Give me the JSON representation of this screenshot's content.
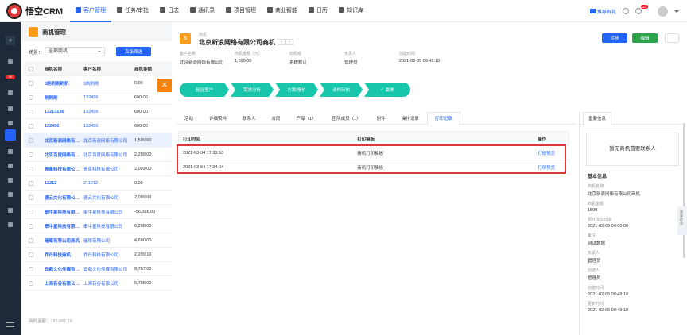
{
  "app": {
    "name": "悟空CRM"
  },
  "nav": {
    "items": [
      {
        "label": "客户管理",
        "active": true
      },
      {
        "label": "任务/审批"
      },
      {
        "label": "日志"
      },
      {
        "label": "通讯录"
      },
      {
        "label": "项目管理"
      },
      {
        "label": "商业智能"
      },
      {
        "label": "日历"
      },
      {
        "label": "知识库"
      }
    ]
  },
  "topright": {
    "upgrade": "推荐有礼",
    "notifications": "22"
  },
  "sidebar": {
    "badge": "99"
  },
  "list_panel": {
    "title": "商机管理",
    "filter_label": "场景：",
    "filter_value": "全部商机",
    "scene_button": "高级筛选",
    "columns": [
      "商机名称",
      "客户名称",
      "商机金额"
    ],
    "rows": [
      {
        "name": "3刷刷刷刷机",
        "customer": "3刷刷刷",
        "amount": "0.00"
      },
      {
        "name": "刷刷刷",
        "customer": "132456",
        "amount": "600.00"
      },
      {
        "name": "13213136",
        "customer": "132456",
        "amount": "600.00"
      },
      {
        "name": "132456",
        "customer": "132456",
        "amount": "600.00"
      },
      {
        "name": "北京新浪网络有限公司商机",
        "customer": "北京新浪网络有限公司",
        "amount": "1,599.00",
        "selected": true
      },
      {
        "name": "北京百度网络有限公司商机",
        "customer": "北京百度网络有限公司",
        "amount": "2,299.00"
      },
      {
        "name": "青蓬科技有限公司商机",
        "customer": "青蓬科技有限公司",
        "amount": "2,099.00"
      },
      {
        "name": "12212",
        "customer": "211212",
        "amount": "0.00"
      },
      {
        "name": "德云文化有限公司商机",
        "customer": "德云文化有限公司",
        "amount": "2,099.00"
      },
      {
        "name": "牵牛星科技有限公司商机",
        "customer": "牵牛星科技有限公司",
        "amount": "-56,388.00"
      },
      {
        "name": "牵牛星科技有限公司商机",
        "customer": "牵牛星科技有限公司",
        "amount": "6,298.00"
      },
      {
        "name": "璀璨有限公司商机",
        "customer": "璀璨有限公司",
        "amount": "4,690.00"
      },
      {
        "name": "乔丹科技商机",
        "customer": "乔丹科技有限公司",
        "amount": "2,209.10"
      },
      {
        "name": "云鼎文化传媒有限公司商机",
        "customer": "云鼎文化传媒有限公司",
        "amount": "8,787.00"
      },
      {
        "name": "上海有谷有限公司商机",
        "customer": "上海有谷有限公司",
        "amount": "5,798.00"
      }
    ],
    "total": "商机金额：155,661.10"
  },
  "detail": {
    "type_label": "商机",
    "title": "北京新浪网络有限公司商机",
    "buttons": {
      "transfer": "转移",
      "edit": "编辑",
      "more": "···"
    },
    "summary": [
      {
        "label": "客户名称",
        "value": "北京新浪网络有限公司"
      },
      {
        "label": "商机金额（元）",
        "value": "1,599.00"
      },
      {
        "label": "商机组",
        "value": "系统默认"
      },
      {
        "label": "负责人",
        "value": "管理员"
      },
      {
        "label": "创建时间",
        "value": "2021-02-05 09:49:18"
      }
    ],
    "stages": [
      "验证客户",
      "需求分析",
      "方案/报价",
      "谈判审核",
      "赢单"
    ],
    "tabs": [
      "活动",
      "详细资料",
      "联系人",
      "合同",
      "产品（1）",
      "团队成员（1）",
      "附件",
      "操作记录",
      "打印记录"
    ],
    "active_tab": 8,
    "print_table": {
      "columns": [
        "打印时间",
        "打印模板",
        "操作"
      ],
      "rows": [
        {
          "time": "2021-03-04 17:33:53",
          "template": "商机打印模板",
          "action": "打印预览"
        },
        {
          "time": "2021-03-04 17:34:04",
          "template": "商机打印模板",
          "action": "打印预览"
        }
      ]
    }
  },
  "right_panel": {
    "tab": "重要信息",
    "empty_contact": "暂无商机首要联系人",
    "section": "基本信息",
    "handle": "重要信息",
    "fields": [
      {
        "label": "商机名称",
        "value": "北京新浪网络有限公司商机"
      },
      {
        "label": "商机金额",
        "value": "1599"
      },
      {
        "label": "预计成交日期",
        "value": "2021-02-09 00:00:00"
      },
      {
        "label": "备注",
        "value": "测试数据"
      },
      {
        "label": "负责人",
        "value": "管理员"
      },
      {
        "label": "创建人",
        "value": "管理员"
      },
      {
        "label": "创建时间",
        "value": "2021-02-05 09:49:18"
      },
      {
        "label": "更新时间",
        "value": "2021-02-05 09:49:18"
      }
    ]
  },
  "colors": {
    "primary": "#2362fb",
    "stage": "#18c7ab",
    "highlight": "#d93a3a",
    "orange": "#f7820e"
  }
}
